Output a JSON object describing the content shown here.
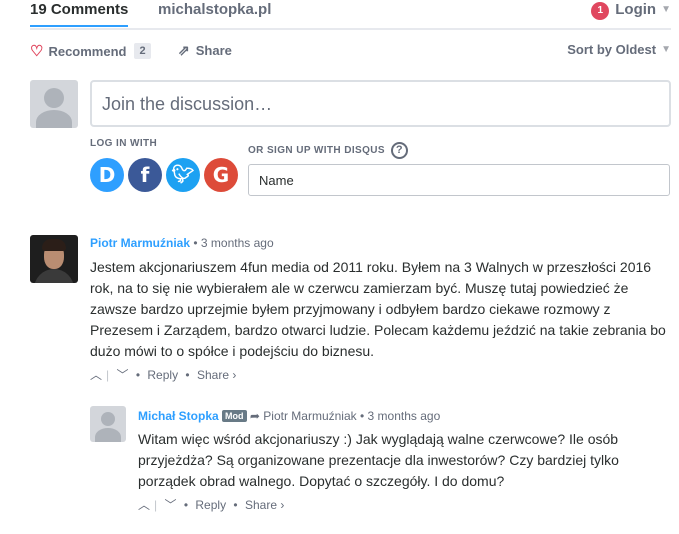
{
  "nav": {
    "comments_count": "19 Comments",
    "site": "michalstopka.pl",
    "notification_count": "1",
    "login": "Login"
  },
  "toolbar": {
    "recommend": "Recommend",
    "recommend_count": "2",
    "share": "Share",
    "sort": "Sort by Oldest"
  },
  "compose": {
    "placeholder": "Join the discussion…",
    "login_with": "LOG IN WITH",
    "signup_with": "OR SIGN UP WITH DISQUS",
    "name_placeholder": "Name",
    "providers": [
      "D",
      "f",
      "t",
      "G"
    ]
  },
  "comments": [
    {
      "author": "Piotr Marmuźniak",
      "time": "3 months ago",
      "text": "Jestem akcjonariuszem 4fun media od 2011 roku. Byłem na 3 Walnych w przeszłości 2016 rok, na to się nie wybierałem ale w czerwcu zamierzam być. Muszę tutaj powiedzieć że zawsze bardzo uprzejmie byłem przyjmowany i odbyłem bardzo ciekawe rozmowy z Prezesem i Zarządem, bardzo otwarci ludzie. Polecam każdemu jeździć na takie zebrania bo dużo mówi to o spółce i podejściu do biznesu.",
      "reply": "Reply",
      "share": "Share ›"
    },
    {
      "author": "Michał Stopka",
      "badge": "Mod",
      "in_reply_to": "Piotr Marmuźniak",
      "time": "3 months ago",
      "text": "Witam więc wśród akcjonariuszy :) Jak wyglądają walne czerwcowe? Ile osób przyjeżdża? Są organizowane prezentacje dla inwestorów? Czy bardziej tylko porządek obrad walnego. Dopytać o szczegóły. I do domu?",
      "reply": "Reply",
      "share": "Share ›"
    }
  ],
  "colors": {
    "accent": "#2e9fff",
    "notification": "#e0475f",
    "disqus": "#2e9fff",
    "facebook": "#3b5998",
    "twitter": "#1da1f2",
    "google": "#dd4b39"
  }
}
